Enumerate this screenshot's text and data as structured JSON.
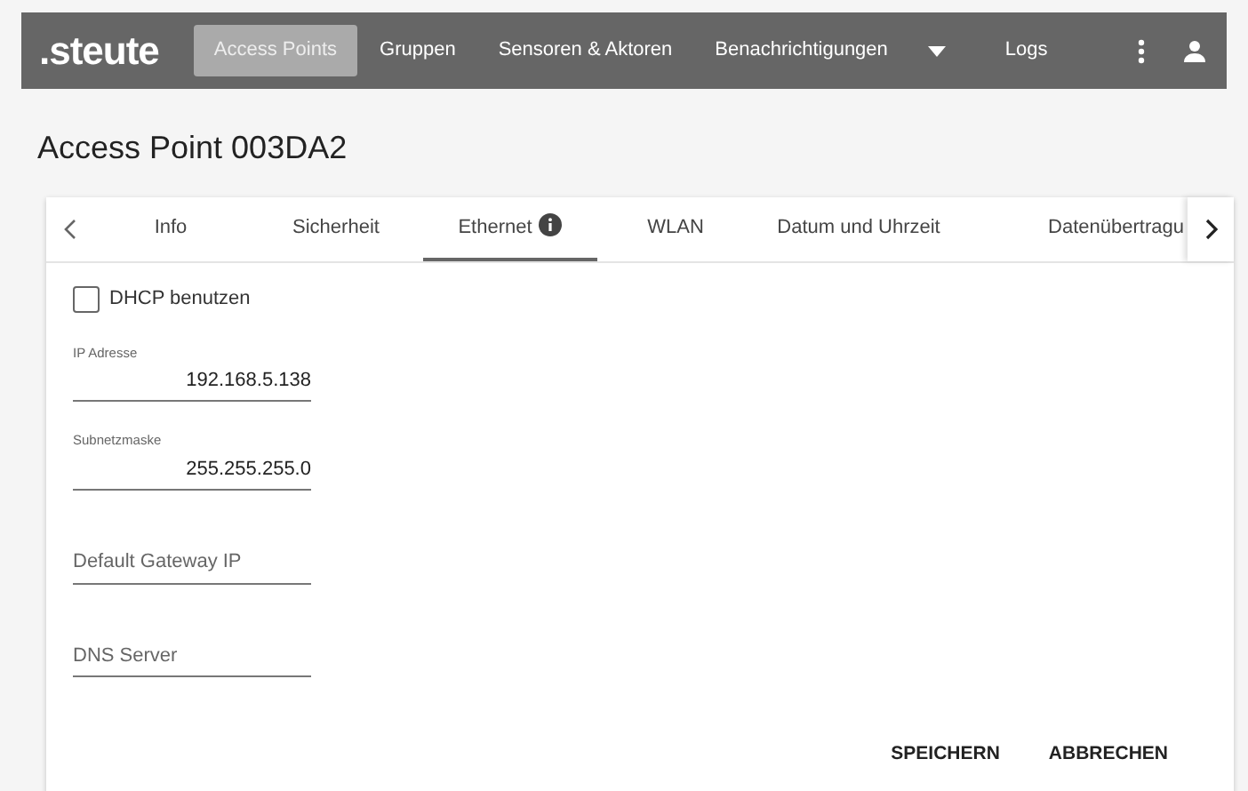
{
  "navbar": {
    "logo": ".steute",
    "items": [
      {
        "label": "Access Points",
        "selected": true
      },
      {
        "label": "Gruppen",
        "selected": false
      },
      {
        "label": "Sensoren & Aktoren",
        "selected": false
      },
      {
        "label": "Benachrichtigungen",
        "selected": false
      },
      {
        "label": "Logs",
        "selected": false
      }
    ]
  },
  "page": {
    "title": "Access Point 003DA2"
  },
  "tabs": [
    {
      "label": "Info",
      "selected": false,
      "info": false
    },
    {
      "label": "Sicherheit",
      "selected": false,
      "info": false
    },
    {
      "label": "Ethernet",
      "selected": true,
      "info": true
    },
    {
      "label": "WLAN",
      "selected": false,
      "info": false
    },
    {
      "label": "Datum und Uhrzeit",
      "selected": false,
      "info": false
    },
    {
      "label": "Datenübertragu",
      "selected": false,
      "info": false
    }
  ],
  "dhcp": {
    "label": "DHCP benutzen",
    "checked": false
  },
  "fields": [
    {
      "label": "IP Adresse",
      "value": "192.168.5.138"
    },
    {
      "label": "Subnetzmaske",
      "value": "255.255.255.0"
    },
    {
      "placeholder": "Default Gateway IP"
    },
    {
      "placeholder": "DNS Server"
    }
  ],
  "buttons": [
    "SPEICHERN",
    "ABBRECHEN"
  ]
}
